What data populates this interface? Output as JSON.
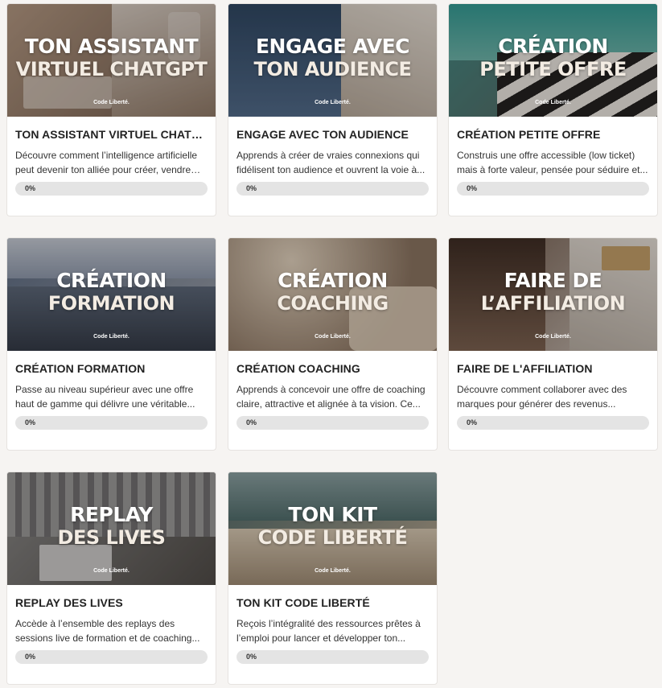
{
  "brand": "Code Liberté.",
  "courses": [
    {
      "img_line1": "TON ASSISTANT",
      "img_line2": "VIRTUEL CHATGPT",
      "title": "TON ASSISTANT VIRTUEL CHATGPT",
      "description": "Découvre comment l’intelligence artificielle peut devenir ton alliée pour créer, vendre et...",
      "progress_label": "0%",
      "progress": 0,
      "bg": [
        "#b49a84",
        "#6e5a4c"
      ],
      "theme": "desk"
    },
    {
      "img_line1": "ENGAGE AVEC",
      "img_line2": "TON AUDIENCE",
      "title": "ENGAGE AVEC TON AUDIENCE",
      "description": "Apprends à créer de vraies connexions qui fidélisent ton audience et ouvrent la voie à...",
      "progress_label": "0%",
      "progress": 0,
      "bg": [
        "#3d5878",
        "#7f8c98"
      ],
      "theme": "yacht"
    },
    {
      "img_line1": "CRÉATION",
      "img_line2": "PETITE OFFRE",
      "title": "CRÉATION PETITE OFFRE",
      "description": "Construis une offre accessible (low ticket) mais à forte valeur, pensée pour séduire et...",
      "progress_label": "0%",
      "progress": 0,
      "bg": [
        "#3f8a86",
        "#5a5a55"
      ],
      "theme": "pool"
    },
    {
      "img_line1": "CRÉATION",
      "img_line2": "FORMATION",
      "title": "CRÉATION FORMATION",
      "description": "Passe au niveau supérieur avec une offre haut de gamme qui délivre une véritable...",
      "progress_label": "0%",
      "progress": 0,
      "bg": [
        "#5b6c85",
        "#9aa2ad"
      ],
      "theme": "boat"
    },
    {
      "img_line1": "CRÉATION",
      "img_line2": "COACHING",
      "title": "CRÉATION COACHING",
      "description": "Apprends à concevoir une offre de coaching claire, attractive et alignée à ta vision. Ce...",
      "progress_label": "0%",
      "progress": 0,
      "bg": [
        "#8c7a6a",
        "#c4ae92"
      ],
      "theme": "jet"
    },
    {
      "img_line1": "FAIRE DE",
      "img_line2": "L’AFFILIATION",
      "title": "FAIRE DE L'AFFILIATION",
      "description": "Découvre comment collaborer avec des marques pour générer des revenus...",
      "progress_label": "0%",
      "progress": 0,
      "bg": [
        "#6a5446",
        "#cfc7bf"
      ],
      "theme": "magazines"
    },
    {
      "img_line1": "REPLAY",
      "img_line2": "DES LIVES",
      "title": "REPLAY DES LIVES",
      "description": "Accède à l’ensemble des replays des sessions live de formation et de coaching...",
      "progress_label": "0%",
      "progress": 0,
      "bg": [
        "#8b8c8c",
        "#4c4a47"
      ],
      "theme": "city"
    },
    {
      "img_line1": "TON KIT",
      "img_line2": "CODE LIBERTÉ",
      "title": "TON KIT CODE LIBERTÉ",
      "description": "Reçois l’intégralité des ressources prêtes à l’emploi pour lancer et développer ton...",
      "progress_label": "0%",
      "progress": 0,
      "bg": [
        "#4e6a6a",
        "#b8a892"
      ],
      "theme": "deck"
    }
  ]
}
